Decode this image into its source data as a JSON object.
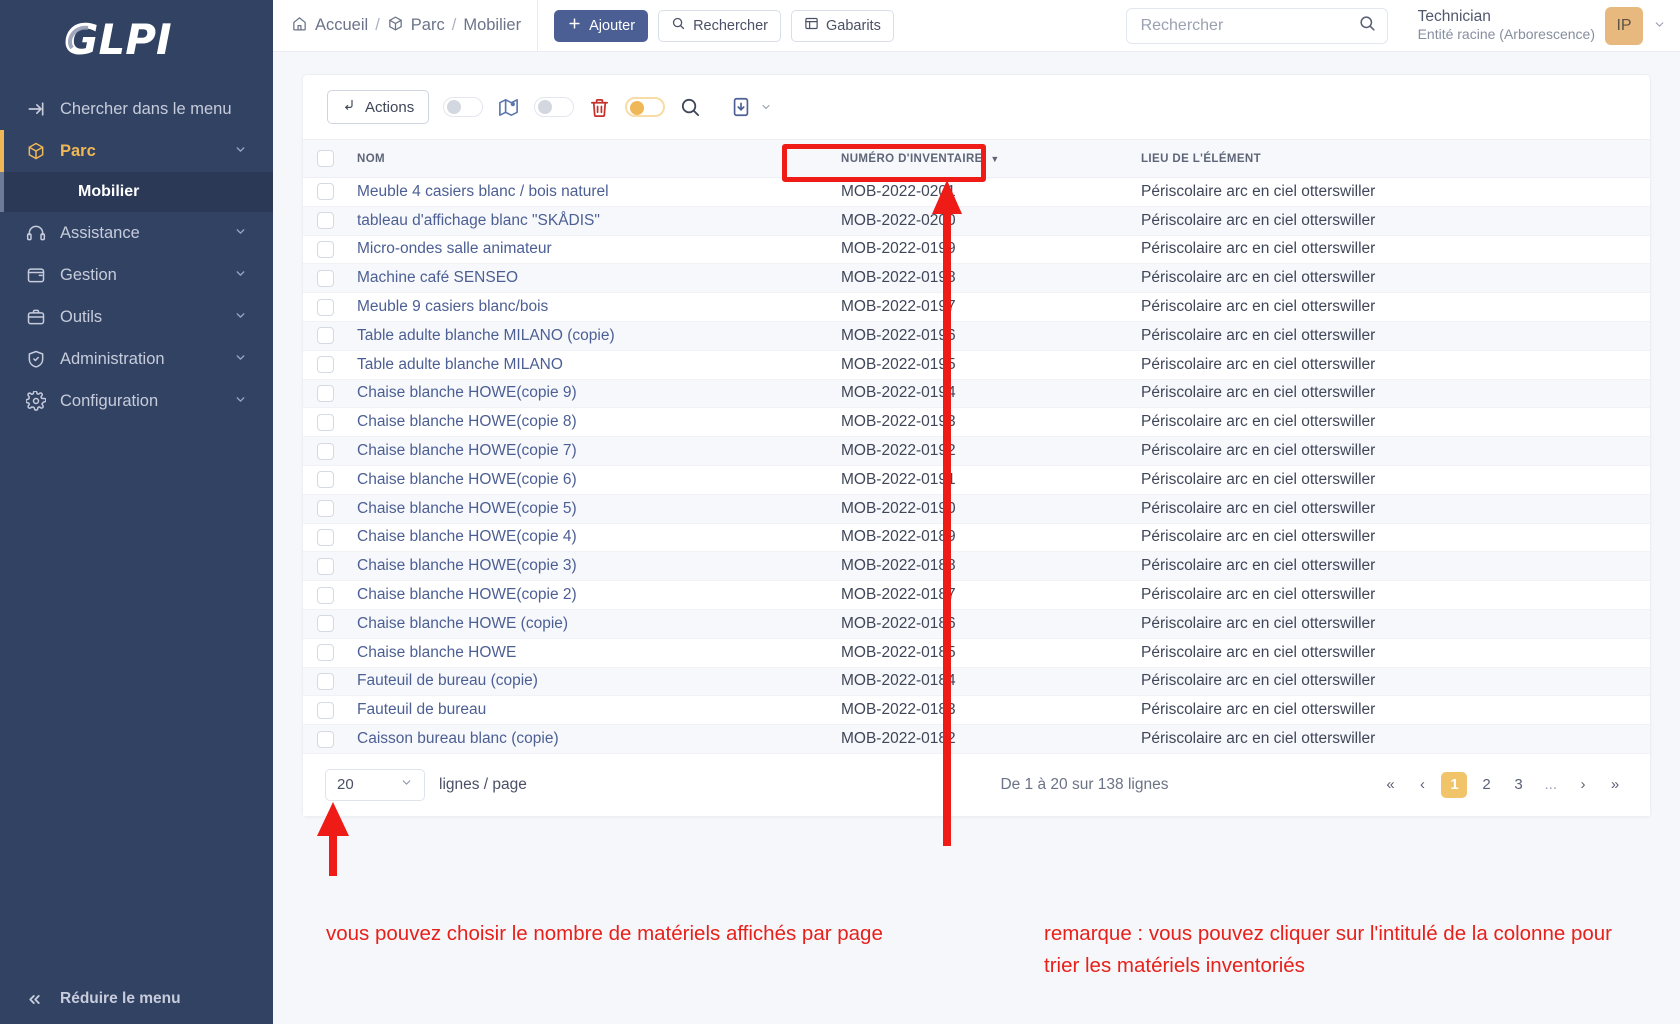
{
  "sidebar": {
    "logo": "GLPI",
    "search_menu": {
      "label": "Chercher dans le menu",
      "icon": "arrow-right-icon"
    },
    "items": [
      {
        "label": "Parc",
        "icon": "package-icon",
        "active": true,
        "chevron": "⌄"
      },
      {
        "label": "Assistance",
        "icon": "headset-icon",
        "active": false,
        "chevron": "⌄"
      },
      {
        "label": "Gestion",
        "icon": "wallet-icon",
        "active": false,
        "chevron": "⌄"
      },
      {
        "label": "Outils",
        "icon": "briefcase-icon",
        "active": false,
        "chevron": "⌄"
      },
      {
        "label": "Administration",
        "icon": "shield-icon",
        "active": false,
        "chevron": "⌄"
      },
      {
        "label": "Configuration",
        "icon": "gear-icon",
        "active": false,
        "chevron": "⌄"
      }
    ],
    "submenu": {
      "label": "Mobilier"
    },
    "collapse": {
      "label": "Réduire le menu",
      "icon": "chevrons-left-icon"
    }
  },
  "header": {
    "breadcrumb": [
      {
        "label": "Accueil",
        "icon": "home-icon"
      },
      {
        "label": "Parc",
        "icon": "package-icon"
      },
      {
        "label": "Mobilier",
        "icon": ""
      }
    ],
    "separator": "/",
    "buttons": [
      {
        "label": "Ajouter",
        "icon": "plus-icon",
        "style": "primary"
      },
      {
        "label": "Rechercher",
        "icon": "search-icon",
        "style": "outline"
      },
      {
        "label": "Gabarits",
        "icon": "template-icon",
        "style": "outline"
      }
    ],
    "search": {
      "placeholder": "Rechercher",
      "value": "",
      "icon": "search-icon"
    },
    "user": {
      "name": "Technician",
      "entity": "Entité racine (Arborescence)",
      "avatar_initials": "IP",
      "avatar_color": "#e7b97e",
      "chevron": "⌄"
    }
  },
  "toolbar": {
    "actions_label": "Actions",
    "actions_icon": "corner-down-left-icon",
    "toggle_map": {
      "name": "map-toggle",
      "state": "off"
    },
    "map_icon": "map-pin-icon",
    "toggle_delete": {
      "name": "delete-toggle",
      "state": "off"
    },
    "delete_icon": "trash-icon",
    "toggle_search": {
      "name": "search-toggle",
      "state": "on"
    },
    "search_icon": "search-icon",
    "export_icon": "file-download-icon",
    "export_chevron": "⌄"
  },
  "table": {
    "columns": [
      {
        "key": "name",
        "label": "NOM",
        "sorted": false
      },
      {
        "key": "inventory",
        "label": "NUMÉRO D'INVENTAIRE",
        "sorted": true,
        "sort_icon": "▼"
      },
      {
        "key": "location",
        "label": "LIEU DE L'ÉLÉMENT",
        "sorted": false
      }
    ],
    "rows": [
      {
        "name": "Meuble 4 casiers blanc / bois naturel",
        "inventory": "MOB-2022-0201",
        "location": "Périscolaire arc en ciel otterswiller"
      },
      {
        "name": "tableau d'affichage blanc \"SKÅDIS\"",
        "inventory": "MOB-2022-0200",
        "location": "Périscolaire arc en ciel otterswiller"
      },
      {
        "name": "Micro-ondes salle animateur",
        "inventory": "MOB-2022-0199",
        "location": "Périscolaire arc en ciel otterswiller"
      },
      {
        "name": "Machine café SENSEO",
        "inventory": "MOB-2022-0198",
        "location": "Périscolaire arc en ciel otterswiller"
      },
      {
        "name": "Meuble 9 casiers blanc/bois",
        "inventory": "MOB-2022-0197",
        "location": "Périscolaire arc en ciel otterswiller"
      },
      {
        "name": "Table adulte blanche MILANO (copie)",
        "inventory": "MOB-2022-0196",
        "location": "Périscolaire arc en ciel otterswiller"
      },
      {
        "name": "Table adulte blanche MILANO",
        "inventory": "MOB-2022-0195",
        "location": "Périscolaire arc en ciel otterswiller"
      },
      {
        "name": "Chaise blanche HOWE(copie 9)",
        "inventory": "MOB-2022-0194",
        "location": "Périscolaire arc en ciel otterswiller"
      },
      {
        "name": "Chaise blanche HOWE(copie 8)",
        "inventory": "MOB-2022-0193",
        "location": "Périscolaire arc en ciel otterswiller"
      },
      {
        "name": "Chaise blanche HOWE(copie 7)",
        "inventory": "MOB-2022-0192",
        "location": "Périscolaire arc en ciel otterswiller"
      },
      {
        "name": "Chaise blanche HOWE(copie 6)",
        "inventory": "MOB-2022-0191",
        "location": "Périscolaire arc en ciel otterswiller"
      },
      {
        "name": "Chaise blanche HOWE(copie 5)",
        "inventory": "MOB-2022-0190",
        "location": "Périscolaire arc en ciel otterswiller"
      },
      {
        "name": "Chaise blanche HOWE(copie 4)",
        "inventory": "MOB-2022-0189",
        "location": "Périscolaire arc en ciel otterswiller"
      },
      {
        "name": "Chaise blanche HOWE(copie 3)",
        "inventory": "MOB-2022-0188",
        "location": "Périscolaire arc en ciel otterswiller"
      },
      {
        "name": "Chaise blanche HOWE(copie 2)",
        "inventory": "MOB-2022-0187",
        "location": "Périscolaire arc en ciel otterswiller"
      },
      {
        "name": "Chaise blanche HOWE (copie)",
        "inventory": "MOB-2022-0186",
        "location": "Périscolaire arc en ciel otterswiller"
      },
      {
        "name": "Chaise blanche HOWE",
        "inventory": "MOB-2022-0185",
        "location": "Périscolaire arc en ciel otterswiller"
      },
      {
        "name": "Fauteuil de bureau (copie)",
        "inventory": "MOB-2022-0184",
        "location": "Périscolaire arc en ciel otterswiller"
      },
      {
        "name": "Fauteuil de bureau",
        "inventory": "MOB-2022-0183",
        "location": "Périscolaire arc en ciel otterswiller"
      },
      {
        "name": "Caisson bureau blanc (copie)",
        "inventory": "MOB-2022-0182",
        "location": "Périscolaire arc en ciel otterswiller"
      }
    ]
  },
  "footer": {
    "rows_per_page_value": "20",
    "rows_per_page_chevron": "⌄",
    "rows_label": "lignes / page",
    "range_text": "De 1 à 20 sur 138 lignes",
    "pagination": {
      "first": "«",
      "prev": "‹",
      "pages": [
        "1",
        "2",
        "3"
      ],
      "current": "1",
      "dots": "...",
      "next": "›",
      "last": "»"
    }
  },
  "annotations": {
    "color": "#e8201a",
    "note_rows_per_page": "vous pouvez choisir le nombre de matériels affichés par page",
    "note_sort_column": "remarque : vous pouvez cliquer sur l'intitulé de la colonne pour trier les matériels inventoriés"
  }
}
